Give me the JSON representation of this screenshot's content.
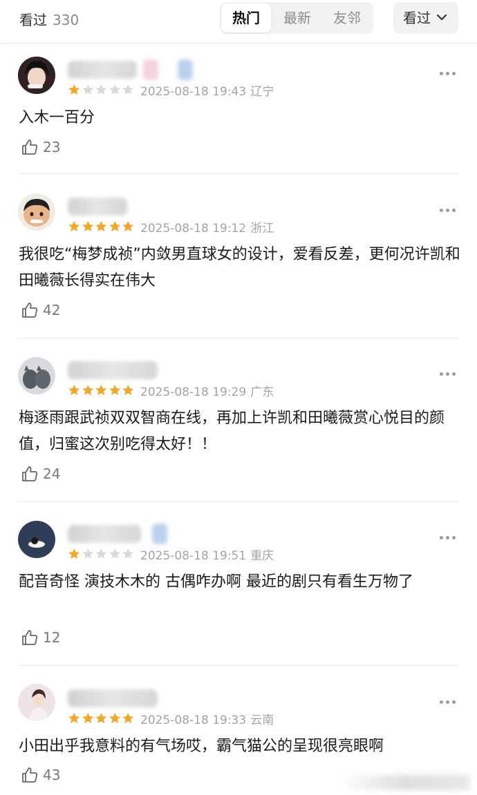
{
  "header": {
    "watched_label": "看过",
    "watched_count": "330",
    "tabs": [
      {
        "label": "热门",
        "active": true
      },
      {
        "label": "最新",
        "active": false
      },
      {
        "label": "友邻",
        "active": false
      }
    ],
    "filter_label": "看过"
  },
  "comments": [
    {
      "rating": 1,
      "time": "2025-08-18 19:43",
      "region": "辽宁",
      "text": "入木一百分",
      "likes": "23"
    },
    {
      "rating": 5,
      "time": "2025-08-18 19:12",
      "region": "浙江",
      "text": "我很吃“梅梦成祯”内敛男直球女的设计，爱看反差，更何况许凯和田曦薇长得实在伟大",
      "likes": "42"
    },
    {
      "rating": 5,
      "time": "2025-08-18 19:29",
      "region": "广东",
      "text": "梅逐雨跟武祯双双智商在线，再加上许凯和田曦薇赏心悦目的颜值，归蜜这次别吃得太好！！",
      "likes": "24"
    },
    {
      "rating": 1,
      "time": "2025-08-18 19:51",
      "region": "重庆",
      "text": "配音奇怪 演技木木的 古偶咋办啊 最近的剧只有看生万物了",
      "likes": "12"
    },
    {
      "rating": 5,
      "time": "2025-08-18 19:33",
      "region": "云南",
      "text": "小田出乎我意料的有气场哎，霸气猫公的呈现很亮眼啊",
      "likes": "43"
    }
  ],
  "colors": {
    "star_filled": "#f5a623",
    "star_empty": "#d9d9d9",
    "meta": "#a3a3a3"
  }
}
